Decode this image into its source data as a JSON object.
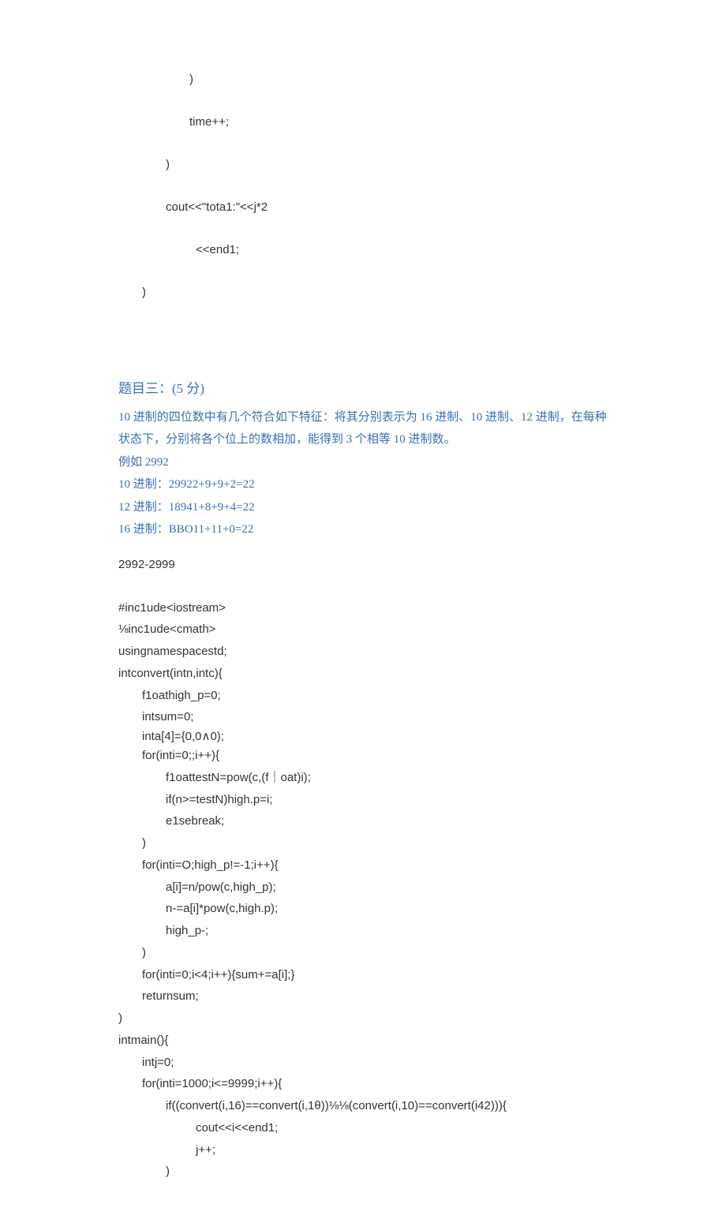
{
  "topcode": {
    "l1": ")",
    "l2": "time++;",
    "l3": ")",
    "l4": "cout<<\"tota1:\"<<j*2",
    "l5": "<<end1;",
    "l6": ")"
  },
  "q3": {
    "title": "题目三：(5 分)",
    "d1": "10 进制的四位数中有几个符合如下特征：将其分别表示为 16 进制、10 进制、12 进制，在每种",
    "d2": "状态下，分别将各个位上的数相加，能得到 3 个相等 10 进制数。",
    "d3": "例如 2992",
    "d4": "10 进制：29922+9+9+2=22",
    "d5": "12 进制：18941+8+9+4=22",
    "d6": "16 进制：BBO11+11+0=22"
  },
  "range": "2992-2999",
  "code": {
    "l01": "#inc1ude<iostream>",
    "l02": "⅛inc1ude<cmath>",
    "l03": "usingnamespacestd;",
    "l04": "intconvert(intn,intc){",
    "l05": "f1oathigh_p=0;",
    "l06": "intsum=0;",
    "l07": "inta[4]={0,0∧0);",
    "l08": "for(inti=0;;i++){",
    "l09": "f1oattestN=pow(c,(f｜oat)i);",
    "l10": "if(n>=testN)high.p=i;",
    "l11": "e1sebreak;",
    "l12": ")",
    "l13": "for(inti=O;high_p!=-1;i++){",
    "l14": "a[i]=n/pow(c,high_p);",
    "l15": "n-=a[i]*pow(c,high.p);",
    "l16": "high_p-;",
    "l17": ")",
    "l18": "for(inti=0;i<4;i++){sum+=a[i];}",
    "l19": "returnsum;",
    "l20": ")",
    "l21": "intmain(){",
    "l22": "intj=0;",
    "l23": "for(inti=1000;i<=9999;i++){",
    "l24": "if((convert(i,16)==convert(i,1θ))⅛⅛(convert(i,10)==convert(i42))){",
    "l25": "cout<<i<<end1;",
    "l26": "j++;",
    "l27": ")"
  }
}
